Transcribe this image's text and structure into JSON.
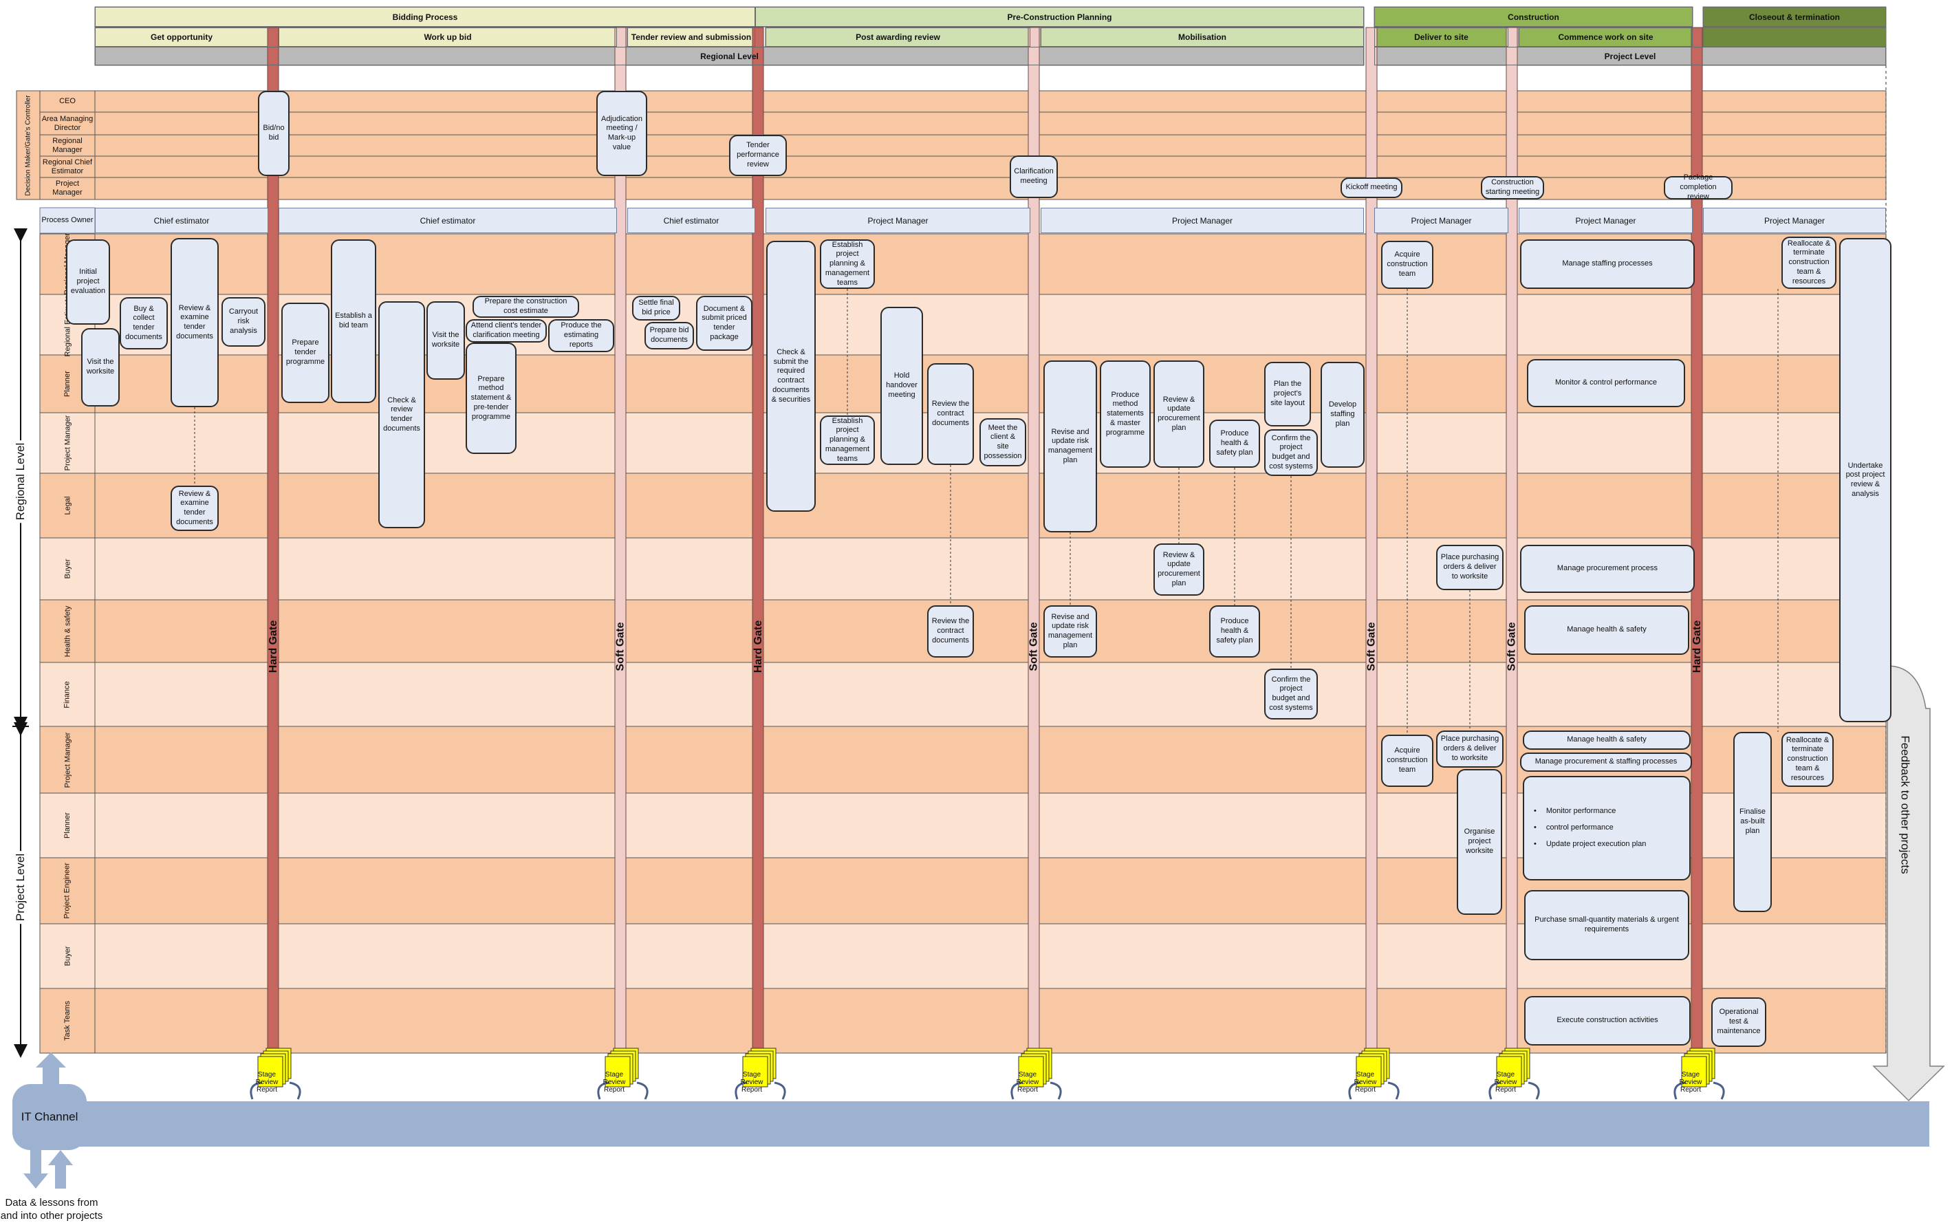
{
  "colors": {
    "lane_dark": "#f8c7a3",
    "lane_light": "#fce3d1",
    "hard_gate": "#c6675f",
    "soft_gate": "#f0cdc9",
    "node_fill": "#e3e9f5",
    "bidding_header": "#ecedc4",
    "preconstruction_header": "#cfe0b3",
    "construction_header": "#92b654",
    "closeout_header": "#6f8a3c",
    "level_bar": "#b9b9b9",
    "it_channel": "#9db2d0"
  },
  "stages": [
    {
      "label": "Bidding Process"
    },
    {
      "label": "Pre-Construction Planning"
    },
    {
      "label": "Construction"
    },
    {
      "label": "Closeout & termination"
    }
  ],
  "substages": [
    {
      "label": "Get opportunity"
    },
    {
      "label": "Work up bid"
    },
    {
      "label": "Tender review and submission"
    },
    {
      "label": "Post awarding review"
    },
    {
      "label": "Mobilisation"
    },
    {
      "label": "Deliver to site"
    },
    {
      "label": "Commence work on site"
    }
  ],
  "levels": [
    {
      "label": "Regional Level"
    },
    {
      "label": "Project Level"
    }
  ],
  "decision_group_label": "Decision Maker/Gate's Controller",
  "decision_lanes": [
    {
      "label": "CEO"
    },
    {
      "label": "Area Managing Director"
    },
    {
      "label": "Regional Manager"
    },
    {
      "label": "Regional Chief Estimator"
    },
    {
      "label": "Project Manager"
    }
  ],
  "process_owner_label": "Process Owner",
  "process_owners": [
    {
      "label": "Chief estimator"
    },
    {
      "label": "Chief estimator"
    },
    {
      "label": "Chief estimator"
    },
    {
      "label": "Project Manager"
    },
    {
      "label": "Project Manager"
    },
    {
      "label": "Project Manager"
    },
    {
      "label": "Project Manager"
    },
    {
      "label": "Project Manager"
    }
  ],
  "regional_lanes": [
    {
      "label": "Regional Manager"
    },
    {
      "label": "Regional Estimator"
    },
    {
      "label": "Planner"
    },
    {
      "label": "Project Manager"
    },
    {
      "label": "Legal"
    },
    {
      "label": "Buyer"
    },
    {
      "label": "Health & safety"
    },
    {
      "label": "Finance"
    }
  ],
  "project_lanes": [
    {
      "label": "Project Manager"
    },
    {
      "label": "Planner"
    },
    {
      "label": "Project Engineer"
    },
    {
      "label": "Buyer"
    },
    {
      "label": "Task Teams"
    }
  ],
  "side_labels": {
    "regional": "Regional Level",
    "project": "Project Level"
  },
  "gates": [
    {
      "kind": "hard",
      "label": "Hard Gate"
    },
    {
      "kind": "soft",
      "label": "Soft Gate"
    },
    {
      "kind": "hard",
      "label": "Hard Gate"
    },
    {
      "kind": "soft",
      "label": "Soft Gate"
    },
    {
      "kind": "soft",
      "label": "Soft Gate"
    },
    {
      "kind": "soft",
      "label": "Soft Gate"
    },
    {
      "kind": "hard",
      "label": "Hard Gate"
    }
  ],
  "decision_meetings": [
    {
      "label": "Bid/no bid"
    },
    {
      "label": "Adjudication meeting / Mark-up value"
    },
    {
      "label": "Tender performance review"
    },
    {
      "label": "Clarification meeting"
    },
    {
      "label": "Kickoff meeting"
    },
    {
      "label": "Construction starting meeting"
    },
    {
      "label": "Package completion review"
    }
  ],
  "activities": [
    {
      "label": "Initial project evaluation"
    },
    {
      "label": "Visit the worksite"
    },
    {
      "label": "Buy & collect tender documents"
    },
    {
      "label": "Review & examine tender documents"
    },
    {
      "label": "Carryout risk analysis"
    },
    {
      "label": "Review & examine tender documents"
    },
    {
      "label": "Prepare tender programme"
    },
    {
      "label": "Establish a bid team"
    },
    {
      "label": "Check & review tender documents"
    },
    {
      "label": "Visit the worksite"
    },
    {
      "label": "Prepare the construction cost estimate"
    },
    {
      "label": "Attend client's tender clarification meeting"
    },
    {
      "label": "Produce the estimating reports"
    },
    {
      "label": "Prepare method statement & pre-tender programme"
    },
    {
      "label": "Settle final bid price"
    },
    {
      "label": "Prepare bid documents"
    },
    {
      "label": "Document & submit priced tender package"
    },
    {
      "label": "Check & submit the required contract documents & securities"
    },
    {
      "label": "Establish project planning & management teams"
    },
    {
      "label": "Establish project planning & management teams"
    },
    {
      "label": "Hold handover meeting"
    },
    {
      "label": "Review the contract documents"
    },
    {
      "label": "Meet the client & site possession"
    },
    {
      "label": "Review the contract documents"
    },
    {
      "label": "Revise and update risk management plan"
    },
    {
      "label": "Produce method statements & master programme"
    },
    {
      "label": "Review & update procurement plan"
    },
    {
      "label": "Review & update procurement plan"
    },
    {
      "label": "Produce health & safety plan"
    },
    {
      "label": "Plan the project's site layout"
    },
    {
      "label": "Confirm the project budget and cost systems"
    },
    {
      "label": "Develop staffing plan"
    },
    {
      "label": "Revise and update risk management plan"
    },
    {
      "label": "Produce health & safety plan"
    },
    {
      "label": "Confirm the project budget and cost systems"
    },
    {
      "label": "Acquire construction team"
    },
    {
      "label": "Place purchasing orders & deliver to worksite"
    },
    {
      "label": "Manage staffing processes"
    },
    {
      "label": "Monitor & control performance"
    },
    {
      "label": "Manage procurement process"
    },
    {
      "label": "Manage health & safety"
    },
    {
      "label": "Reallocate & terminate construction team & resources"
    },
    {
      "label": "Undertake post project review & analysis"
    },
    {
      "label": "Acquire construction team"
    },
    {
      "label": "Place purchasing orders & deliver to worksite"
    },
    {
      "label": "Organise project worksite"
    },
    {
      "label": "Manage health & safety"
    },
    {
      "label": "Manage procurement & staffing processes"
    },
    {
      "label": "Purchase small-quantity materials & urgent requirements"
    },
    {
      "label": "Execute construction activities"
    },
    {
      "label": "Finalise as-built plan"
    },
    {
      "label": "Reallocate & terminate construction team & resources"
    },
    {
      "label": "Operational test & maintenance"
    }
  ],
  "monitor_list": {
    "items": [
      {
        "label": "Monitor performance"
      },
      {
        "label": "control performance"
      },
      {
        "label": "Update project execution plan"
      }
    ]
  },
  "stage_review_report": "Stage Review Report",
  "it_channel_label": "IT Channel",
  "data_lessons_label": "Data & lessons from and into other projects",
  "feedback_label": "Feedback to other projects"
}
